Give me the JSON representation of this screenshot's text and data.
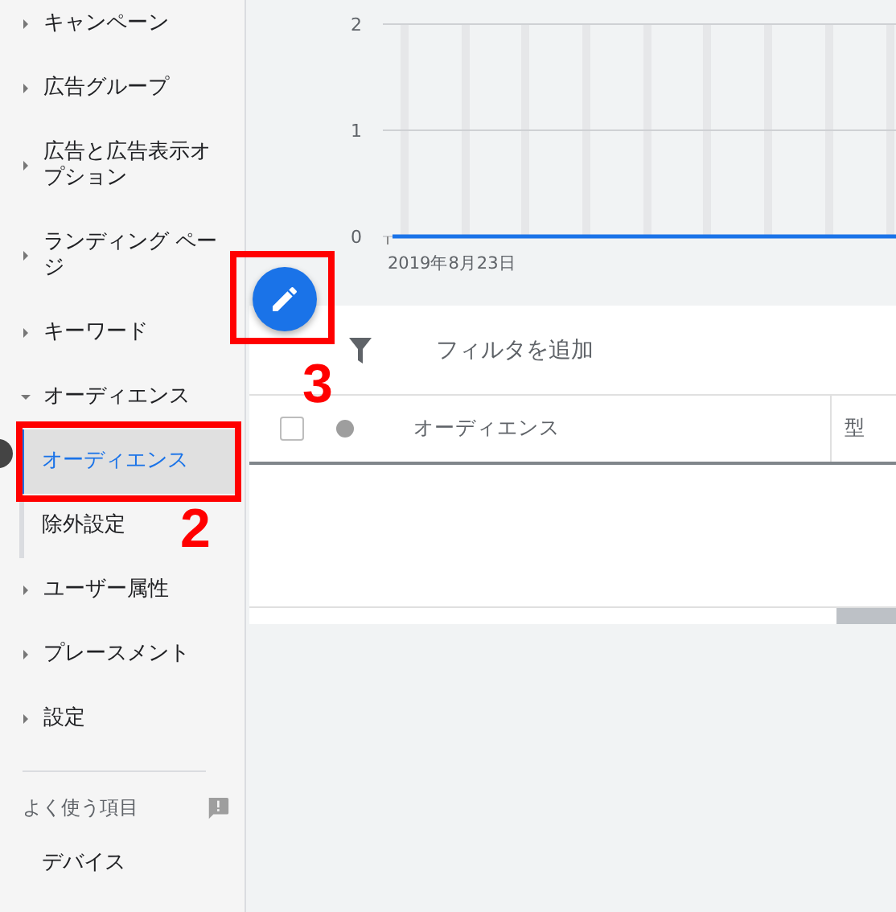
{
  "sidebar": {
    "items": [
      {
        "label": "キャンペーン",
        "expanded": false
      },
      {
        "label": "広告グループ",
        "expanded": false
      },
      {
        "label": "広告と広告表示オプション",
        "expanded": false
      },
      {
        "label": "ランディング ページ",
        "expanded": false
      },
      {
        "label": "キーワード",
        "expanded": false
      },
      {
        "label": "オーディエンス",
        "expanded": true,
        "children": [
          {
            "label": "オーディエンス",
            "selected": true
          },
          {
            "label": "除外設定",
            "selected": false
          }
        ]
      },
      {
        "label": "ユーザー属性",
        "expanded": false
      },
      {
        "label": "プレースメント",
        "expanded": false
      },
      {
        "label": "設定",
        "expanded": false
      }
    ],
    "section": {
      "title": "よく使う項目",
      "items": [
        {
          "label": "デバイス"
        }
      ]
    }
  },
  "chart": {
    "y_labels": [
      "2",
      "1",
      "0"
    ],
    "date_label": "2019年8月23日"
  },
  "toolbar": {
    "filter_label": "フィルタを追加"
  },
  "table": {
    "columns": [
      {
        "label": "オーディエンス"
      },
      {
        "label": "型"
      }
    ],
    "select_all_checked": false
  },
  "callouts": [
    {
      "number": "2"
    },
    {
      "number": "3"
    }
  ]
}
